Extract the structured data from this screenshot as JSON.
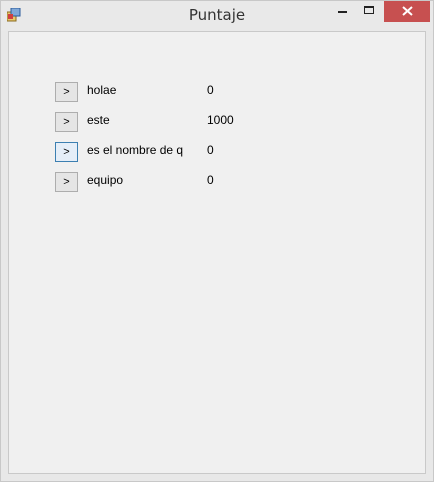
{
  "window": {
    "title": "Puntaje"
  },
  "colors": {
    "close_button": "#c75050",
    "client_background": "#f0f0f0",
    "focus_border": "#3c7fb1"
  },
  "rows": [
    {
      "button_label": ">",
      "name": "holae",
      "score": "0",
      "focused": false
    },
    {
      "button_label": ">",
      "name": "este",
      "score": "1000",
      "focused": false
    },
    {
      "button_label": ">",
      "name": "es el nombre de q",
      "score": "0",
      "focused": true
    },
    {
      "button_label": ">",
      "name": "equipo",
      "score": "0",
      "focused": false
    }
  ]
}
